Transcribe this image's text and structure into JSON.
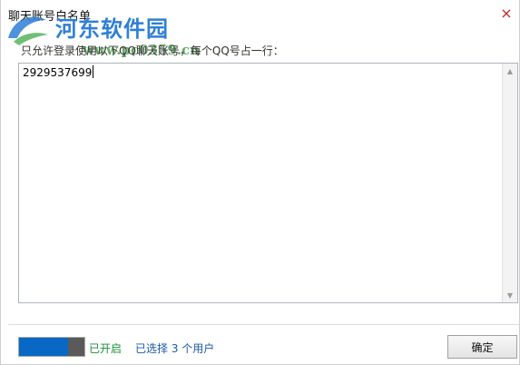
{
  "window": {
    "title": "聊天账号白名单",
    "close_icon": "×"
  },
  "watermark": {
    "site_name": "河东软件园",
    "url": "www.pc0359.cn"
  },
  "instruction": "只允许登录使用以下QQ聊天账号，每个QQ号占一行：",
  "editor": {
    "value": "2929537699"
  },
  "footer": {
    "status": "已开启",
    "selected_users": "已选择 3 个用户",
    "ok_label": "确定"
  },
  "colors": {
    "toggle": "#0a68c5",
    "status": "#1a8f3a",
    "link": "#1a5aa8"
  }
}
